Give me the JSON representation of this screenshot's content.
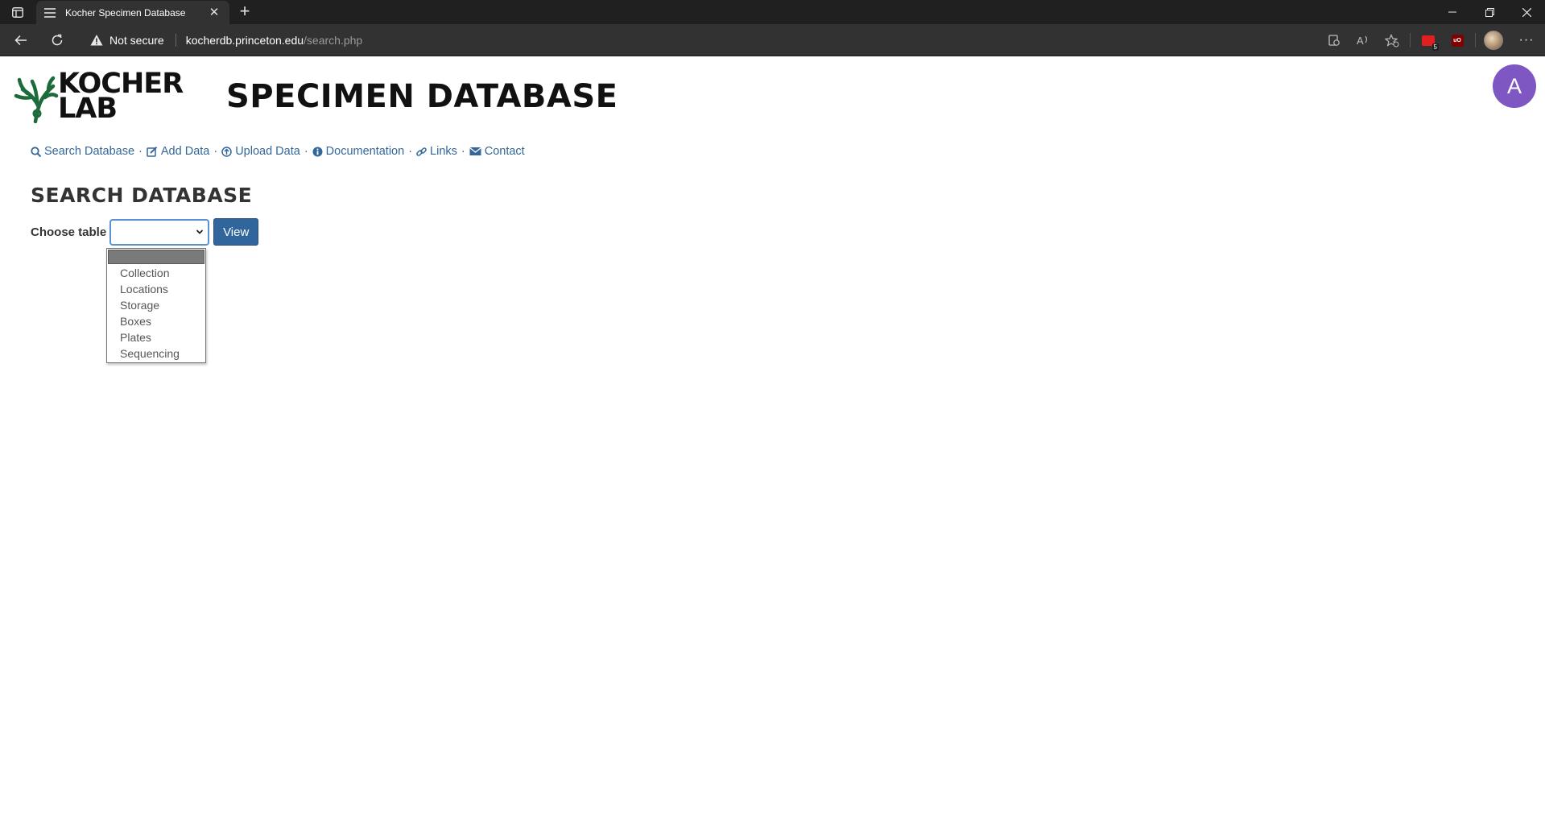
{
  "browser": {
    "tab_title": "Kocher Specimen Database",
    "new_tab_symbol": "+",
    "close_symbol": "✕",
    "security_label": "Not secure",
    "url_host": "kocherdb.princeton.edu",
    "url_path": "/search.php",
    "extension_badge": "5",
    "ublock_label": "uO",
    "menu_dots": "···"
  },
  "header": {
    "logo_line1": "KOCHER",
    "logo_line2": "LAB",
    "site_title": "SPECIMEN DATABASE",
    "avatar_letter": "A",
    "accent_color": "#7e57c2",
    "logo_color": "#1d6b3b"
  },
  "nav": {
    "items": [
      {
        "label": "Search Database",
        "icon": "search-icon"
      },
      {
        "label": "Add Data",
        "icon": "edit-icon"
      },
      {
        "label": "Upload Data",
        "icon": "upload-icon"
      },
      {
        "label": "Documentation",
        "icon": "info-icon"
      },
      {
        "label": "Links",
        "icon": "link-icon"
      },
      {
        "label": "Contact",
        "icon": "envelope-icon"
      }
    ],
    "separator": "·",
    "link_color": "#336699"
  },
  "main": {
    "section_title": "SEARCH DATABASE",
    "choose_label": "Choose table",
    "selected_value": "",
    "view_button": "View",
    "button_color": "#31669c",
    "options": [
      "",
      "Collection",
      "Locations",
      "Storage",
      "Boxes",
      "Plates",
      "Sequencing"
    ]
  }
}
